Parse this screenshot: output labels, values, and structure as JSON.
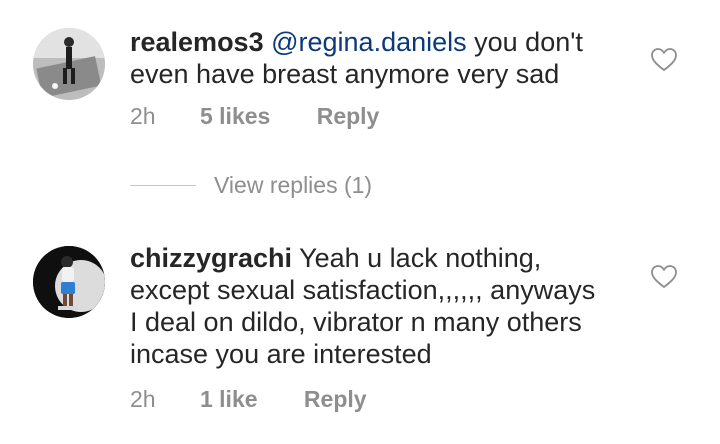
{
  "comments": [
    {
      "username": "realemos3",
      "mention": "@regina.daniels",
      "text_line1": " you don't",
      "text_line2": "even have breast anymore very sad",
      "time": "2h",
      "likes": "5 likes",
      "reply": "Reply",
      "avatar_icon": "avatar-photo",
      "like_icon": "heart-outline-icon"
    },
    {
      "username": "chizzygrachi",
      "text_line1": " Yeah u lack nothing,",
      "text_line2": "except sexual satisfaction,,,,,, anyways",
      "text_line3": "I deal on dildo, vibrator n many others",
      "text_line4": "incase you are interested",
      "time": "2h",
      "likes": "1 like",
      "reply": "Reply",
      "avatar_icon": "avatar-photo",
      "like_icon": "heart-outline-icon"
    }
  ],
  "view_replies": "View replies (1)",
  "colors": {
    "text": "#262626",
    "secondary": "#8e8e8e",
    "mention": "#0a3a7a",
    "divider": "#c7c7c7"
  }
}
